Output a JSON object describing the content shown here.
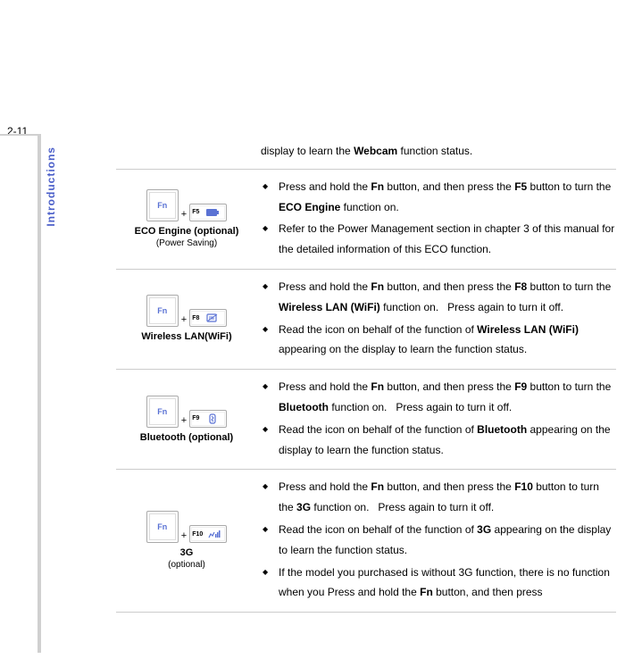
{
  "pageNumber": "2-11",
  "sideTab": "Introductions",
  "fnLabel": "Fn",
  "headerFragment": "display to learn the <b>Webcam</b> function status.",
  "rows": [
    {
      "fxLabel": "F5",
      "icon": "eco",
      "title": "ECO Engine (optional)",
      "sub": "(Power Saving)",
      "bullets": [
        "Press and hold the <b>Fn</b> button, and then press the <b>F5</b> button to turn the <b>ECO Engine</b> function on.",
        "Refer to the Power Management section in chapter 3 of this manual for the detailed information of this ECO function."
      ]
    },
    {
      "fxLabel": "F8",
      "icon": "wifi",
      "title": "Wireless LAN(WiFi)",
      "sub": "",
      "bullets": [
        "Press and hold the <b>Fn</b> button, and then press the <b>F8</b> button to turn the <b>Wireless LAN (WiFi)</b> function on. &nbsp; Press again to turn it off.",
        "Read the icon on behalf of the function of <b>Wireless LAN (WiFi)</b> appearing on the display to learn the function status."
      ]
    },
    {
      "fxLabel": "F9",
      "icon": "bluetooth",
      "title": "Bluetooth (optional)",
      "sub": "",
      "bullets": [
        "Press and hold the <b>Fn</b> button, and then press the <b>F9</b> button to turn the <b>Bluetooth</b> function on. &nbsp; Press again to turn it off.",
        "Read the icon on behalf of the function of <b>Bluetooth</b> appearing on the display to learn the function status."
      ]
    },
    {
      "fxLabel": "F10",
      "icon": "3g",
      "title": "3G",
      "sub": "(optional)",
      "bullets": [
        "Press and hold the <b>Fn</b> button, and then press the <b>F10</b> button to turn the <b>3G</b> function on. &nbsp; Press again to turn it off.",
        "Read the icon on behalf of the function of <b>3G</b> appearing on the display to learn the function status.",
        "If the model you purchased is without 3G function, there is no function when you Press and hold the <b>Fn</b> button, and then press"
      ]
    }
  ]
}
